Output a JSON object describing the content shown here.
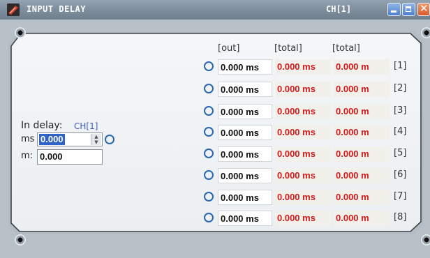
{
  "window": {
    "title": "INPUT DELAY",
    "channel": "CH[1]",
    "icons": [
      "app-logo-icon",
      "minimize-icon",
      "maximize-icon",
      "close-icon"
    ],
    "close_glyph": "✕"
  },
  "headers": {
    "out": "[out]",
    "total": "[total]",
    "total_m": "[total]"
  },
  "rows": [
    {
      "out": "0.000 ms",
      "total_ms": "0.000 ms",
      "total_m": "0.000 m",
      "label": "[1]"
    },
    {
      "out": "0.000 ms",
      "total_ms": "0.000 ms",
      "total_m": "0.000 m",
      "label": "[2]"
    },
    {
      "out": "0.000 ms",
      "total_ms": "0.000 ms",
      "total_m": "0.000 m",
      "label": "[3]"
    },
    {
      "out": "0.000 ms",
      "total_ms": "0.000 ms",
      "total_m": "0.000 m",
      "label": "[4]"
    },
    {
      "out": "0.000 ms",
      "total_ms": "0.000 ms",
      "total_m": "0.000 m",
      "label": "[5]"
    },
    {
      "out": "0.000 ms",
      "total_ms": "0.000 ms",
      "total_m": "0.000 m",
      "label": "[6]"
    },
    {
      "out": "0.000 ms",
      "total_ms": "0.000 ms",
      "total_m": "0.000 m",
      "label": "[7]"
    },
    {
      "out": "0.000 ms",
      "total_ms": "0.000 ms",
      "total_m": "0.000 m",
      "label": "[8]"
    }
  ],
  "in_delay": {
    "label": "In delay:",
    "channel": "CH[1]",
    "ms_label": "ms",
    "ms_value": "0.000",
    "m_label": "m:",
    "m_value": "0.000"
  },
  "colors": {
    "title_gradient": "#7f8f9e",
    "total_text": "#d11a1a",
    "radio": "#2a66b2",
    "selected_value_bg": "#2f63c7",
    "channel_label": "#3a5bb8"
  }
}
